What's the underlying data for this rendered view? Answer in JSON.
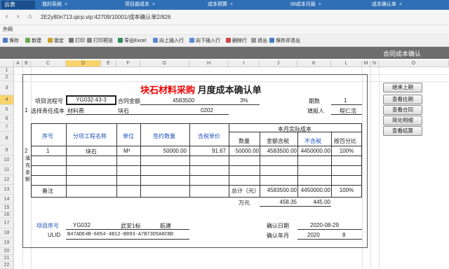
{
  "browser": {
    "brand": "云表",
    "tabs": [
      "我的系统",
      "项目部成本",
      "成本预算",
      "06成本月报",
      "成本确认单"
    ],
    "url": "2E2y80n713.qicp.vip:42709/10001/成本确认单2/826",
    "bookmark": "外网"
  },
  "toolbar": [
    "保存",
    "新建",
    "锁定",
    "打印",
    "打印预览",
    "导出Excel",
    "向上插入行",
    "向下插入行",
    "删除行",
    "退出",
    "保存并退出"
  ],
  "ribbon_title": "合同成本确认",
  "columns": [
    "A",
    "B",
    "C",
    "D",
    "E",
    "F",
    "G",
    "H",
    "I",
    "J",
    "K",
    "L",
    "M",
    "N",
    "O"
  ],
  "rows": [
    "1",
    "2",
    "3",
    "4",
    "5",
    "6",
    "7",
    "8",
    "9",
    "10",
    "11",
    "12",
    "13",
    "14",
    "15",
    "16",
    "17",
    "18",
    "19",
    "20",
    "21",
    "22"
  ],
  "form": {
    "title_red": "块石材料采购",
    "title_black": "月度成本确认单",
    "proj_flow_label": "项目流程号",
    "proj_flow_value": "YG032-43-3",
    "contract_amount_label": "合同金额",
    "contract_amount_value": "4583500",
    "pct_value": "3%",
    "period_label": "期数",
    "period_value": "1",
    "seq_1": "1",
    "select_cost_label": "选择责任成本",
    "material_fee": "材料费",
    "stone": "块石",
    "code": "0202",
    "reporter_label": "填报人",
    "reporter_value": "程仁浩",
    "table_headers": {
      "seq": "序号",
      "project_name": "分项工程名称",
      "unit": "单位",
      "signed_qty": "签约数量",
      "tax_unit_price": "含税单价",
      "month_actual": "本月实际成本",
      "qty": "数量",
      "amount_tax": "金额含税",
      "amount_notax": "不含税",
      "cum_pct": "按百分比"
    },
    "row2_label": "2",
    "fill_amount_label": "填\n充\n金\n额",
    "row": {
      "seq": "1",
      "name": "块石",
      "unit": "M³",
      "signed_qty": "50000.00",
      "price": "91.67",
      "qty": "50000.00",
      "amount_tax": "4583500.00",
      "amount_notax": "4450000.00",
      "pct": "100%"
    },
    "remark_label": "备注",
    "total_label": "总计（元）",
    "total_tax": "4583500.00",
    "total_notax": "4450000.00",
    "total_pct": "100%",
    "wan_label": "万元",
    "wan_tax": "458.35",
    "wan_notax": "445.00",
    "proj_no_label": "项目序号",
    "proj_no_value": "YG032",
    "section": "武安1标",
    "road": "航建",
    "confirm_date_label": "确认日期",
    "confirm_date_value": "2020-08-29",
    "ulid_label": "ULID",
    "ulid_value": "B47ADE4B-6854-4B12-B893-A7B73D5A0CBD",
    "confirm_ym_label": "确认年月",
    "confirm_year": "2020",
    "confirm_month": "8"
  },
  "side_buttons": [
    "继承上期",
    "查看往期",
    "查看合同",
    "简化明细",
    "查看结算"
  ]
}
